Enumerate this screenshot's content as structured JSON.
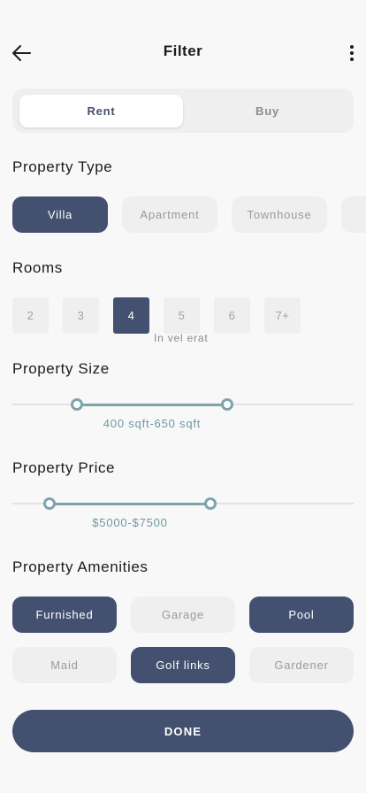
{
  "header": {
    "title": "Filter",
    "back_icon": "arrow-left-icon",
    "menu_icon": "more-vertical-icon"
  },
  "deal_type": {
    "options": [
      "Rent",
      "Buy"
    ],
    "selected": "Rent"
  },
  "property_type": {
    "title": "Property Type",
    "options": [
      "Villa",
      "Apartment",
      "Townhouse"
    ],
    "selected": "Villa"
  },
  "rooms": {
    "title": "Rooms",
    "options": [
      "2",
      "3",
      "4",
      "5",
      "6",
      "7+"
    ],
    "selected": "4",
    "note": "In vel erat"
  },
  "size": {
    "title": "Property Size",
    "range_label": "400 sqft-650 sqft",
    "low_fraction": 0.19,
    "high_fraction": 0.63
  },
  "price": {
    "title": "Property Price",
    "range_label": "$5000-$7500",
    "low_fraction": 0.11,
    "high_fraction": 0.58
  },
  "amenities": {
    "title": "Property Amenities",
    "options": [
      "Furnished",
      "Garage",
      "Pool",
      "Maid",
      "Golf links",
      "Gardener"
    ],
    "selected": [
      "Furnished",
      "Pool",
      "Golf links"
    ]
  },
  "done_label": "DONE",
  "colors": {
    "accent": "#43506f",
    "slider": "#7fa3ad",
    "chip_bg": "#efefef",
    "background": "#f8f8f8"
  }
}
